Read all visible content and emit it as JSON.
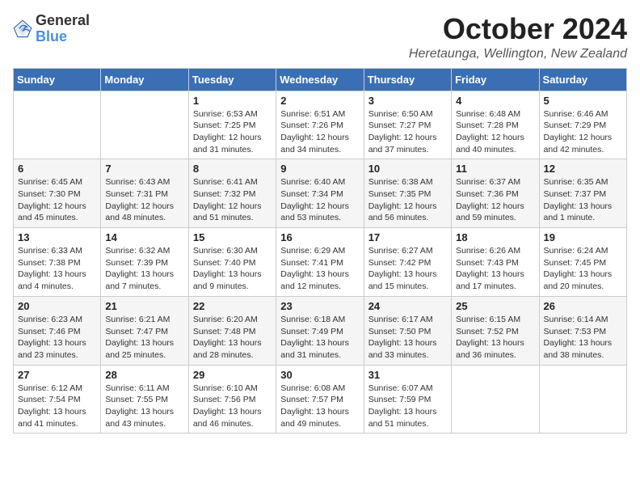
{
  "logo": {
    "text_general": "General",
    "text_blue": "Blue"
  },
  "title": "October 2024",
  "location": "Heretaunga, Wellington, New Zealand",
  "days_of_week": [
    "Sunday",
    "Monday",
    "Tuesday",
    "Wednesday",
    "Thursday",
    "Friday",
    "Saturday"
  ],
  "weeks": [
    [
      {
        "day": "",
        "info": ""
      },
      {
        "day": "",
        "info": ""
      },
      {
        "day": "1",
        "info": "Sunrise: 6:53 AM\nSunset: 7:25 PM\nDaylight: 12 hours and 31 minutes."
      },
      {
        "day": "2",
        "info": "Sunrise: 6:51 AM\nSunset: 7:26 PM\nDaylight: 12 hours and 34 minutes."
      },
      {
        "day": "3",
        "info": "Sunrise: 6:50 AM\nSunset: 7:27 PM\nDaylight: 12 hours and 37 minutes."
      },
      {
        "day": "4",
        "info": "Sunrise: 6:48 AM\nSunset: 7:28 PM\nDaylight: 12 hours and 40 minutes."
      },
      {
        "day": "5",
        "info": "Sunrise: 6:46 AM\nSunset: 7:29 PM\nDaylight: 12 hours and 42 minutes."
      }
    ],
    [
      {
        "day": "6",
        "info": "Sunrise: 6:45 AM\nSunset: 7:30 PM\nDaylight: 12 hours and 45 minutes."
      },
      {
        "day": "7",
        "info": "Sunrise: 6:43 AM\nSunset: 7:31 PM\nDaylight: 12 hours and 48 minutes."
      },
      {
        "day": "8",
        "info": "Sunrise: 6:41 AM\nSunset: 7:32 PM\nDaylight: 12 hours and 51 minutes."
      },
      {
        "day": "9",
        "info": "Sunrise: 6:40 AM\nSunset: 7:34 PM\nDaylight: 12 hours and 53 minutes."
      },
      {
        "day": "10",
        "info": "Sunrise: 6:38 AM\nSunset: 7:35 PM\nDaylight: 12 hours and 56 minutes."
      },
      {
        "day": "11",
        "info": "Sunrise: 6:37 AM\nSunset: 7:36 PM\nDaylight: 12 hours and 59 minutes."
      },
      {
        "day": "12",
        "info": "Sunrise: 6:35 AM\nSunset: 7:37 PM\nDaylight: 13 hours and 1 minute."
      }
    ],
    [
      {
        "day": "13",
        "info": "Sunrise: 6:33 AM\nSunset: 7:38 PM\nDaylight: 13 hours and 4 minutes."
      },
      {
        "day": "14",
        "info": "Sunrise: 6:32 AM\nSunset: 7:39 PM\nDaylight: 13 hours and 7 minutes."
      },
      {
        "day": "15",
        "info": "Sunrise: 6:30 AM\nSunset: 7:40 PM\nDaylight: 13 hours and 9 minutes."
      },
      {
        "day": "16",
        "info": "Sunrise: 6:29 AM\nSunset: 7:41 PM\nDaylight: 13 hours and 12 minutes."
      },
      {
        "day": "17",
        "info": "Sunrise: 6:27 AM\nSunset: 7:42 PM\nDaylight: 13 hours and 15 minutes."
      },
      {
        "day": "18",
        "info": "Sunrise: 6:26 AM\nSunset: 7:43 PM\nDaylight: 13 hours and 17 minutes."
      },
      {
        "day": "19",
        "info": "Sunrise: 6:24 AM\nSunset: 7:45 PM\nDaylight: 13 hours and 20 minutes."
      }
    ],
    [
      {
        "day": "20",
        "info": "Sunrise: 6:23 AM\nSunset: 7:46 PM\nDaylight: 13 hours and 23 minutes."
      },
      {
        "day": "21",
        "info": "Sunrise: 6:21 AM\nSunset: 7:47 PM\nDaylight: 13 hours and 25 minutes."
      },
      {
        "day": "22",
        "info": "Sunrise: 6:20 AM\nSunset: 7:48 PM\nDaylight: 13 hours and 28 minutes."
      },
      {
        "day": "23",
        "info": "Sunrise: 6:18 AM\nSunset: 7:49 PM\nDaylight: 13 hours and 31 minutes."
      },
      {
        "day": "24",
        "info": "Sunrise: 6:17 AM\nSunset: 7:50 PM\nDaylight: 13 hours and 33 minutes."
      },
      {
        "day": "25",
        "info": "Sunrise: 6:15 AM\nSunset: 7:52 PM\nDaylight: 13 hours and 36 minutes."
      },
      {
        "day": "26",
        "info": "Sunrise: 6:14 AM\nSunset: 7:53 PM\nDaylight: 13 hours and 38 minutes."
      }
    ],
    [
      {
        "day": "27",
        "info": "Sunrise: 6:12 AM\nSunset: 7:54 PM\nDaylight: 13 hours and 41 minutes."
      },
      {
        "day": "28",
        "info": "Sunrise: 6:11 AM\nSunset: 7:55 PM\nDaylight: 13 hours and 43 minutes."
      },
      {
        "day": "29",
        "info": "Sunrise: 6:10 AM\nSunset: 7:56 PM\nDaylight: 13 hours and 46 minutes."
      },
      {
        "day": "30",
        "info": "Sunrise: 6:08 AM\nSunset: 7:57 PM\nDaylight: 13 hours and 49 minutes."
      },
      {
        "day": "31",
        "info": "Sunrise: 6:07 AM\nSunset: 7:59 PM\nDaylight: 13 hours and 51 minutes."
      },
      {
        "day": "",
        "info": ""
      },
      {
        "day": "",
        "info": ""
      }
    ]
  ]
}
